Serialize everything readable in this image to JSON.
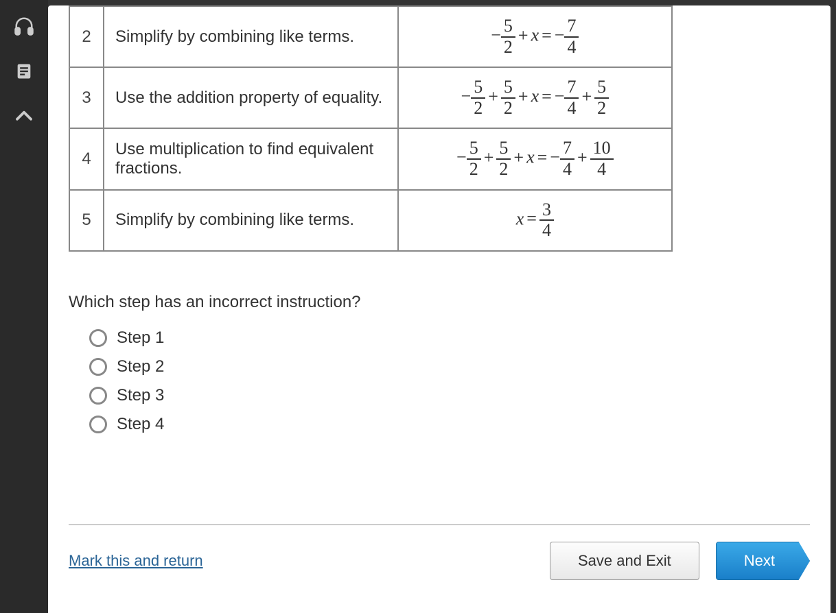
{
  "sidebar": {
    "icons": [
      "headphones-icon",
      "notepad-icon",
      "up-arrow-icon"
    ]
  },
  "table": {
    "rows": [
      {
        "num": "2",
        "desc": "Simplify by combining like terms.",
        "eq_key": "eq2"
      },
      {
        "num": "3",
        "desc": "Use the addition property of equality.",
        "eq_key": "eq3"
      },
      {
        "num": "4",
        "desc": "Use multiplication to find equivalent fractions.",
        "eq_key": "eq4"
      },
      {
        "num": "5",
        "desc": "Simplify by combining like terms.",
        "eq_key": "eq5"
      }
    ]
  },
  "equations": {
    "eq2": "-5/2 + x = -7/4",
    "eq3": "-5/2 + 5/2 + x = -7/4 + 5/2",
    "eq4": "-5/2 + 5/2 + x = -7/4 + 10/4",
    "eq5": "x = 3/4"
  },
  "question": "Which step has an incorrect instruction?",
  "options": [
    {
      "label": "Step 1"
    },
    {
      "label": "Step 2"
    },
    {
      "label": "Step 3"
    },
    {
      "label": "Step 4"
    }
  ],
  "footer": {
    "mark": "Mark this and return",
    "save": "Save and Exit",
    "next": "Next"
  }
}
